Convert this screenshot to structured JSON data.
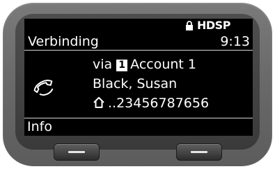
{
  "header": {
    "title": "Verbinding",
    "time": "9:13",
    "hd_label": "HDSP",
    "lock_icon": "lock-icon"
  },
  "call": {
    "via_prefix": "via",
    "account_number": "1",
    "account_name": "Account 1",
    "caller_name": "Black, Susan",
    "number": "..23456787656",
    "call_icon": "handset-icon",
    "number_icon": "home-icon"
  },
  "softkeys": {
    "left_label": "Info"
  },
  "colors": {
    "screen_bg": "#000000",
    "text": "#ffffff",
    "housing": "#6a6a6a"
  }
}
